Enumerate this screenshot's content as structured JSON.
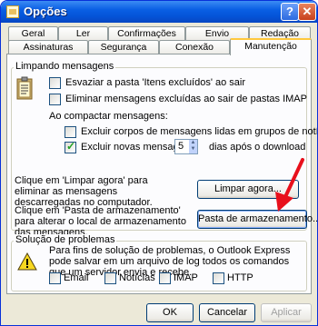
{
  "window": {
    "title": "Opções",
    "help_glyph": "?",
    "close_glyph": "✕"
  },
  "tabs_back": [
    "Geral",
    "Ler",
    "Confirmações",
    "Envio",
    "Redação"
  ],
  "tabs_front": [
    "Assinaturas",
    "Segurança",
    "Conexão",
    "Manutenção"
  ],
  "active_tab": "Manutenção",
  "cleanup": {
    "group_title": "Limpando mensagens",
    "empty_deleted": "Esvaziar a pasta 'Itens excluídos' ao sair",
    "purge_imap": "Eliminar mensagens excluídas ao sair de pastas IMAP",
    "compact_label": "Ao compactar mensagens:",
    "delete_read_bodies": "Excluir corpos de mensagens lidas em grupos de notícias",
    "delete_new": "Excluir novas mensagens",
    "days_value": "5",
    "days_suffix": "dias após o download",
    "cleanup_desc": "Clique em 'Limpar agora' para eliminar as mensagens descarregadas no computador.",
    "cleanup_button": "Limpar agora...",
    "store_desc": "Clique em 'Pasta de armazenamento' para alterar o local de armazenamento das mensagens.",
    "store_button": "Pasta de armazenamento..."
  },
  "troubleshoot": {
    "group_title": "Solução de problemas",
    "desc": "Para fins de solução de problemas, o Outlook Express pode salvar em um arquivo de log todos os comandos que um servidor envia e recebe.",
    "email": "Email",
    "news": "Notícias",
    "imap": "IMAP",
    "http": "HTTP"
  },
  "footer": {
    "ok": "OK",
    "cancel": "Cancelar",
    "apply": "Aplicar"
  },
  "checkbox_state": {
    "empty_deleted": false,
    "purge_imap": false,
    "delete_read_bodies": false,
    "delete_new": true,
    "email": false,
    "news": false,
    "imap": false,
    "http": false
  },
  "colors": {
    "titlebar": "#0a5fe4",
    "annotation_arrow": "#e8101c",
    "tab_highlight": "#ffc83c"
  }
}
